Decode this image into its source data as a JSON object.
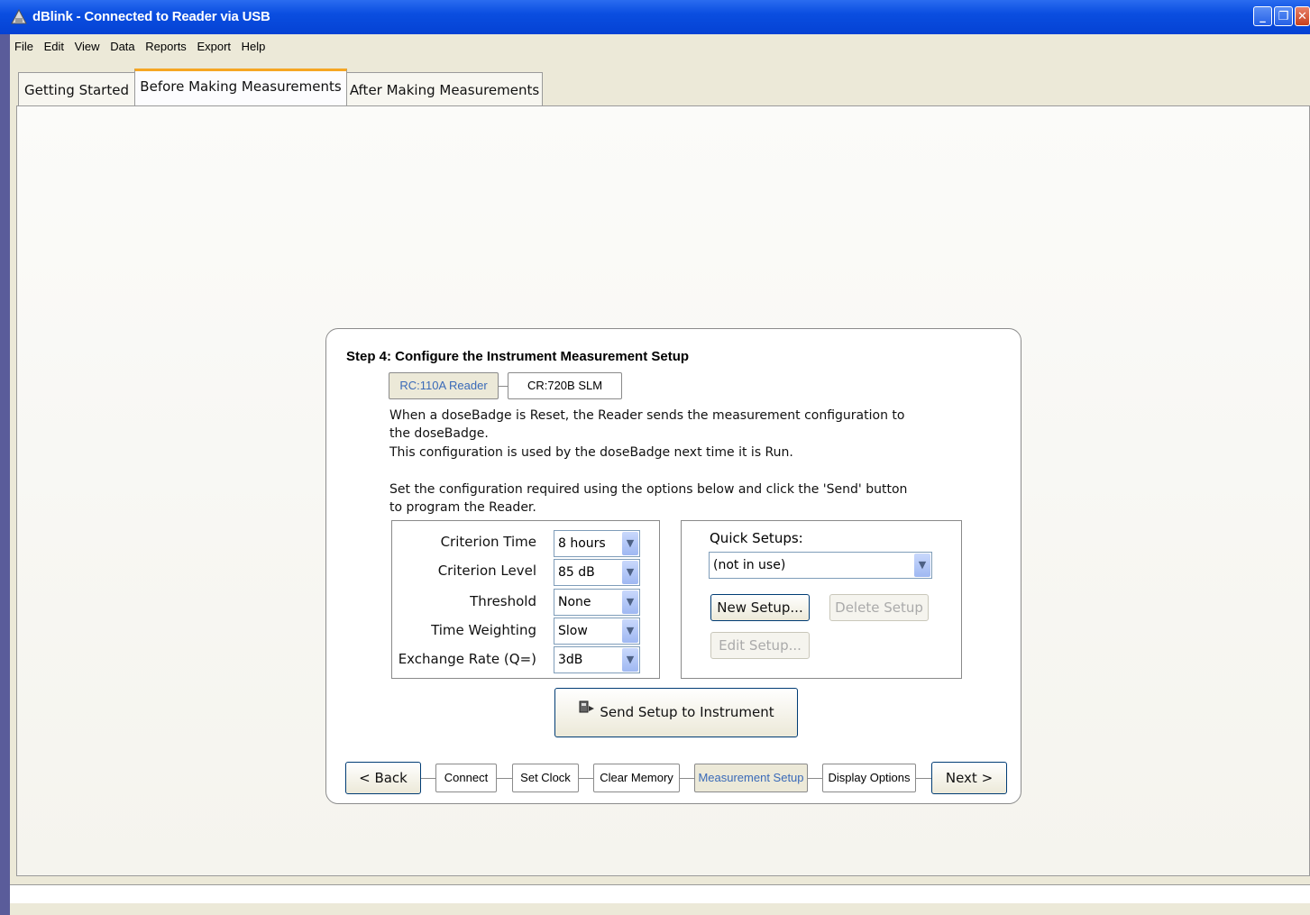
{
  "window": {
    "title": "dBlink - Connected to Reader via USB",
    "icon": "app-icon",
    "controls": {
      "minimize": "_",
      "restore": "❐",
      "close": "✕"
    }
  },
  "menu": [
    "File",
    "Edit",
    "View",
    "Data",
    "Reports",
    "Export",
    "Help"
  ],
  "tabs": [
    {
      "label": "Getting Started"
    },
    {
      "label": "Before Making Measurements",
      "active": true
    },
    {
      "label": "After Making Measurements"
    }
  ],
  "step": {
    "title": "Step 4: Configure the Instrument Measurement Setup",
    "instruments": [
      {
        "label": "RC:110A Reader",
        "active": true
      },
      {
        "label": "CR:720B SLM"
      }
    ],
    "para1_line1": "When a doseBadge is Reset, the Reader sends the measurement configuration to",
    "para1_line2": "the doseBadge.",
    "para1_line3": "This configuration is used by the doseBadge next time it is Run.",
    "para2_line1": "Set the configuration required using the options below and click the 'Send' button",
    "para2_line2": "to program the Reader.",
    "fields": [
      {
        "label": "Criterion Time",
        "value": "8 hours"
      },
      {
        "label": "Criterion Level",
        "value": "85 dB"
      },
      {
        "label": "Threshold",
        "value": "None"
      },
      {
        "label": "Time Weighting",
        "value": "Slow"
      },
      {
        "label": "Exchange Rate (Q=)",
        "value": "3dB"
      }
    ],
    "quick_setups": {
      "label": "Quick Setups:",
      "value": "(not in use)",
      "new_label": "New Setup...",
      "delete_label": "Delete Setup",
      "edit_label": "Edit Setup..."
    },
    "send_label": "Send Setup to Instrument",
    "nav": {
      "back": "< Back",
      "next": "Next >",
      "steps": [
        {
          "label": "Connect"
        },
        {
          "label": "Set Clock"
        },
        {
          "label": "Clear Memory"
        },
        {
          "label": "Measurement Setup",
          "active": true
        },
        {
          "label": "Display Options"
        }
      ]
    }
  },
  "colors": {
    "titlebar": "#0a4ee0",
    "active_tab_accent": "#f5a623",
    "active_chip_text": "#3a6ab8"
  }
}
